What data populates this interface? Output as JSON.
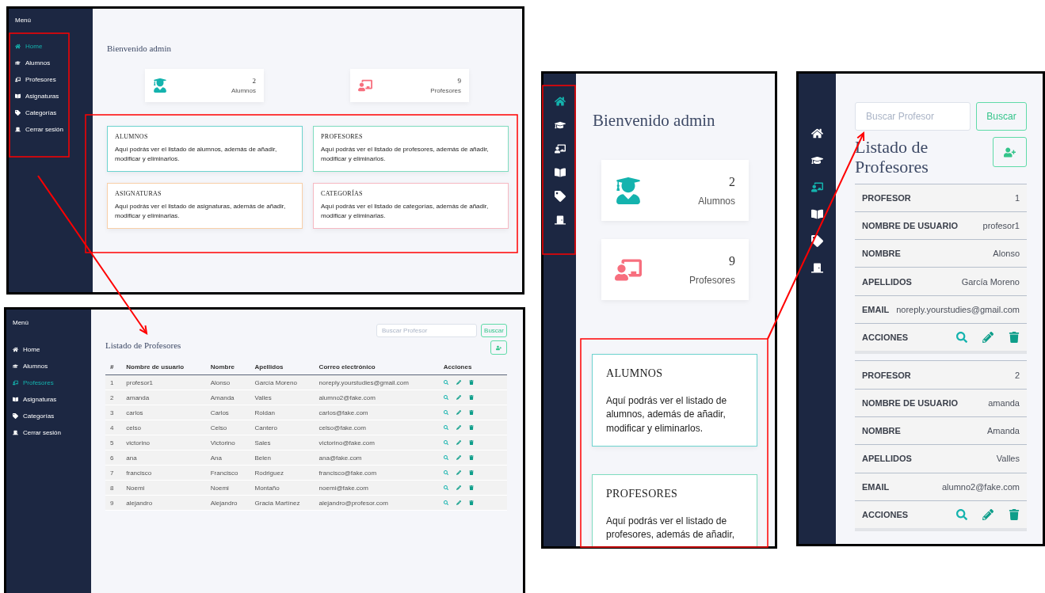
{
  "dashboard_desktop": {
    "menu_title": "Menú",
    "menu": [
      {
        "label": "Home",
        "selected": true
      },
      {
        "label": "Alumnos",
        "selected": false
      },
      {
        "label": "Profesores",
        "selected": false
      },
      {
        "label": "Asignaturas",
        "selected": false
      },
      {
        "label": "Categorías",
        "selected": false
      },
      {
        "label": "Cerrar sesión",
        "selected": false
      }
    ],
    "greeting": "Bienvenido admin",
    "stats": [
      {
        "value": "2",
        "label": "Alumnos",
        "color": "#14b3ae"
      },
      {
        "value": "9",
        "label": "Profesores",
        "color": "#f76f7e"
      }
    ],
    "cards": [
      {
        "title": "ALUMNOS",
        "text": "Aquí podrás ver el listado de alumnos, además de añadir, modificar y eliminarlos.",
        "color": "#6dd3cf"
      },
      {
        "title": "PROFESORES",
        "text": "Aquí podrás ver el listado de profesores, además de añadir, modificar y eliminarlos.",
        "color": "#7fdcc0"
      },
      {
        "title": "ASIGNATURAS",
        "text": "Aquí podrás ver el listado de asignaturas, además de añadir, modificar y eliminarlas.",
        "color": "#f8cfa8"
      },
      {
        "title": "CATEGORÍAS",
        "text": "Aquí podrás ver el listado de categorías, además de añadir, modificar y eliminarlas.",
        "color": "#f6b8c2"
      }
    ]
  },
  "profesores_desktop": {
    "menu_title": "Menú",
    "menu": [
      {
        "label": "Home",
        "selected": false
      },
      {
        "label": "Alumnos",
        "selected": false
      },
      {
        "label": "Profesores",
        "selected": true
      },
      {
        "label": "Asignaturas",
        "selected": false
      },
      {
        "label": "Categorías",
        "selected": false
      },
      {
        "label": "Cerrar sesión",
        "selected": false
      }
    ],
    "search": {
      "placeholder": "Buscar Profesor"
    },
    "search_button": "Buscar",
    "title": "Listado de Profesores",
    "columns": [
      "#",
      "Nombre de usuario",
      "Nombre",
      "Apellidos",
      "Correo electrónico",
      "Acciones"
    ],
    "rows": [
      [
        "1",
        "profesor1",
        "Alonso",
        "García Moreno",
        "noreply.yourstudies@gmail.com"
      ],
      [
        "2",
        "amanda",
        "Amanda",
        "Valles",
        "alumno2@fake.com"
      ],
      [
        "3",
        "carlos",
        "Carlos",
        "Roldan",
        "carlos@fake.com"
      ],
      [
        "4",
        "celso",
        "Celso",
        "Cantero",
        "celso@fake.com"
      ],
      [
        "5",
        "victorino",
        "Victorino",
        "Sales",
        "victorino@fake.com"
      ],
      [
        "6",
        "ana",
        "Ana",
        "Belen",
        "ana@fake.com"
      ],
      [
        "7",
        "francisco",
        "Francisco",
        "Rodriguez",
        "francisco@fake.com"
      ],
      [
        "8",
        "Noemi",
        "Noemi",
        "Montaño",
        "noemi@fake.com"
      ],
      [
        "9",
        "alejandro",
        "Alejandro",
        "Gracia Martínez",
        "alejandro@profesor.com"
      ]
    ]
  },
  "dashboard_mobile": {
    "menu": [
      {
        "selected": true
      },
      {
        "selected": false
      },
      {
        "selected": false
      },
      {
        "selected": false
      },
      {
        "selected": false
      },
      {
        "selected": false
      }
    ],
    "greeting": "Bienvenido admin",
    "stats": [
      {
        "value": "2",
        "label": "Alumnos",
        "color": "#14b3ae"
      },
      {
        "value": "9",
        "label": "Profesores",
        "color": "#f76f7e"
      }
    ],
    "cards": [
      {
        "title": "ALUMNOS",
        "text": "Aquí podrás ver el listado de alumnos, además de añadir, modificar y eliminarlos.",
        "color": "#6dd3cf"
      },
      {
        "title": "PROFESORES",
        "text": "Aquí podrás ver el listado de profesores, además de añadir,",
        "color": "#7fdcc0"
      }
    ]
  },
  "profesores_mobile": {
    "menu": [
      {
        "selected": false
      },
      {
        "selected": false
      },
      {
        "selected": true
      },
      {
        "selected": false
      },
      {
        "selected": false
      },
      {
        "selected": false
      }
    ],
    "search": {
      "placeholder": "Buscar Profesor"
    },
    "search_button": "Buscar",
    "title": "Listado de Profesores",
    "records": [
      {
        "fields": [
          {
            "label": "PROFESOR",
            "value": "1"
          },
          {
            "label": "NOMBRE DE USUARIO",
            "value": "profesor1"
          },
          {
            "label": "NOMBRE",
            "value": "Alonso"
          },
          {
            "label": "APELLIDOS",
            "value": "García Moreno"
          },
          {
            "label": "EMAIL",
            "value": "noreply.yourstudies@gmail.com"
          }
        ],
        "actions_label": "ACCIONES"
      },
      {
        "fields": [
          {
            "label": "PROFESOR",
            "value": "2"
          },
          {
            "label": "NOMBRE DE USUARIO",
            "value": "amanda"
          },
          {
            "label": "NOMBRE",
            "value": "Amanda"
          },
          {
            "label": "APELLIDOS",
            "value": "Valles"
          },
          {
            "label": "EMAIL",
            "value": "alumno2@fake.com"
          }
        ],
        "actions_label": "ACCIONES"
      }
    ]
  }
}
